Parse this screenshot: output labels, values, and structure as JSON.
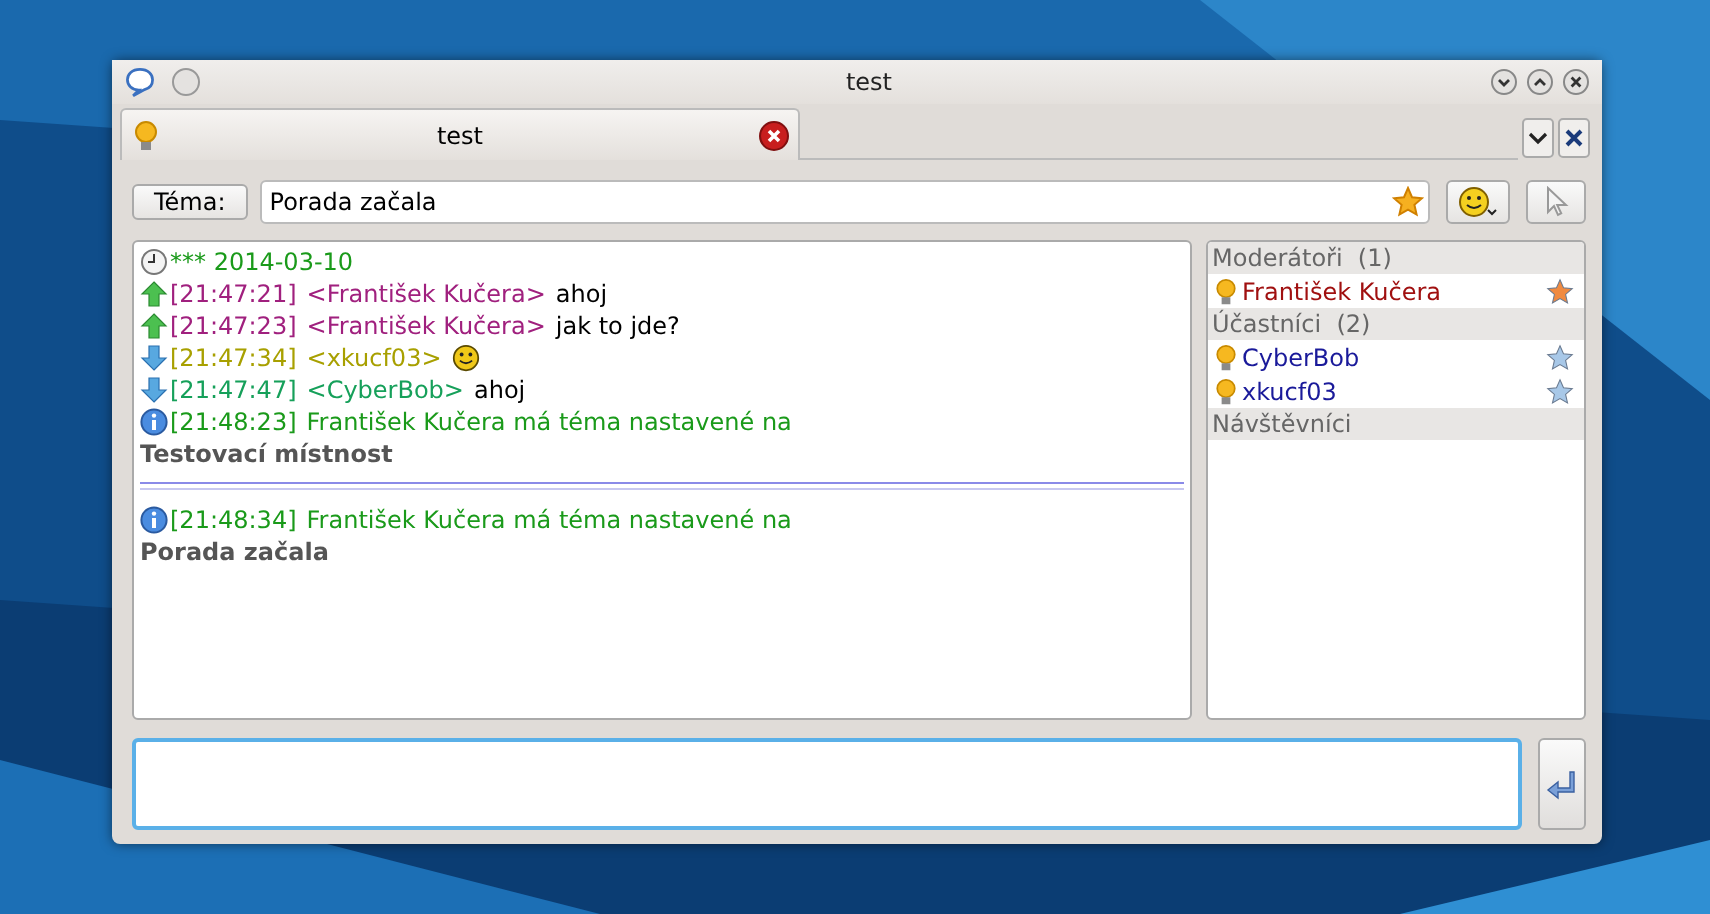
{
  "window": {
    "title": "test"
  },
  "tabs": [
    {
      "label": "test",
      "selected": true
    }
  ],
  "topic": {
    "button": "Téma:",
    "value": "Porada začala"
  },
  "messages": [
    {
      "kind": "date",
      "text": "*** 2014-03-10"
    },
    {
      "kind": "outgoing",
      "time": "[21:47:21]",
      "nick": "<František Kučera>",
      "text": "ahoj",
      "color": "#a0207e"
    },
    {
      "kind": "outgoing",
      "time": "[21:47:23]",
      "nick": "<František Kučera>",
      "text": "jak to jde?",
      "color": "#a0207e"
    },
    {
      "kind": "incoming",
      "time": "[21:47:34]",
      "nick": "<xkucf03>",
      "smiley": true,
      "color": "#a8a000"
    },
    {
      "kind": "incoming",
      "time": "[21:47:47]",
      "nick": "<CyberBob>",
      "text": "ahoj",
      "color": "#16a05a"
    },
    {
      "kind": "topic",
      "time": "[21:48:23]",
      "text": "František Kučera má téma nastavené na",
      "topic": "Testovací místnost"
    },
    {
      "kind": "marker"
    },
    {
      "kind": "topic",
      "time": "[21:48:34]",
      "text": "František Kučera má téma nastavené na",
      "topic": "Porada začala"
    }
  ],
  "roster": [
    {
      "title": "Moderátoři",
      "count": "(1)",
      "members": [
        {
          "name": "František Kučera",
          "kind": "moderator",
          "color": "#a01010"
        }
      ]
    },
    {
      "title": "Účastníci",
      "count": "(2)",
      "members": [
        {
          "name": "CyberBob",
          "kind": "participant",
          "color": "#1a1a9a"
        },
        {
          "name": "xkucf03",
          "kind": "participant",
          "color": "#1a1a9a"
        }
      ]
    },
    {
      "title": "Návštěvníci"
    }
  ]
}
